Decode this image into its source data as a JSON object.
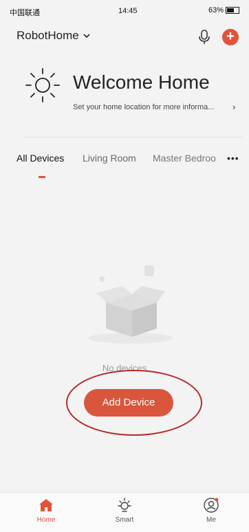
{
  "status_bar": {
    "carrier": "中国联通",
    "time": "14:45",
    "battery": "63%",
    "battery_level": 0.63
  },
  "header": {
    "home_name": "RobotHome",
    "dropdown_icon": "chevron-down-icon",
    "mic_icon": "microphone-icon",
    "add_icon": "plus-circle-icon",
    "add_glyph": "+"
  },
  "welcome": {
    "title": "Welcome Home",
    "subtitle": "Set your home location for more informa...",
    "chevron": "›",
    "icon": "sun-icon"
  },
  "tabs": [
    {
      "label": "All Devices",
      "active": true
    },
    {
      "label": "Living Room",
      "active": false
    },
    {
      "label": "Master Bedroo",
      "active": false
    }
  ],
  "tabs_more": "•••",
  "empty_state": {
    "message": "No devices",
    "button_label": "Add Device"
  },
  "tab_bar": [
    {
      "label": "Home",
      "icon": "home-icon",
      "active": true
    },
    {
      "label": "Smart",
      "icon": "smart-sun-icon",
      "active": false
    },
    {
      "label": "Me",
      "icon": "profile-icon",
      "active": false
    }
  ],
  "colors": {
    "accent": "#e0533a",
    "annotation": "#b8282b",
    "background": "#f3f3f3"
  }
}
